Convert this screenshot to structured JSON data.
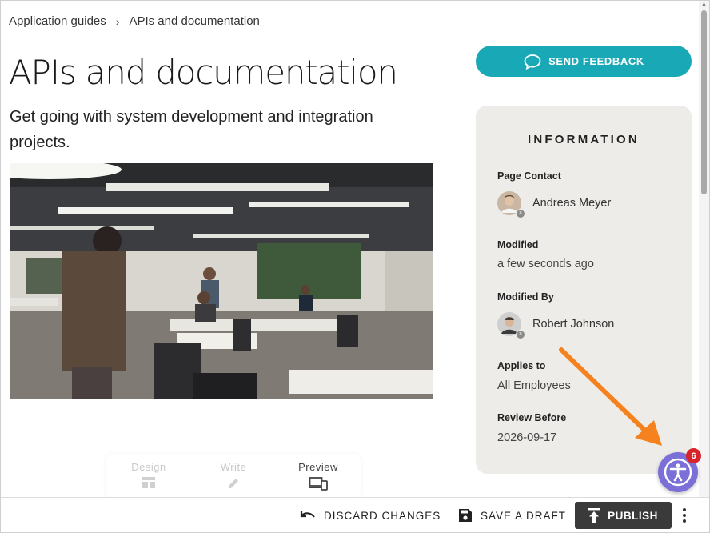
{
  "breadcrumb": {
    "parent": "Application guides",
    "separator": "›",
    "current": "APIs and documentation"
  },
  "page": {
    "title": "APIs and documentation",
    "subtitle": "Get going with system development and integration projects."
  },
  "feedback": {
    "label": "SEND FEEDBACK",
    "icon": "chat-bubble-icon",
    "color": "#19a9b6"
  },
  "info": {
    "heading": "INFORMATION",
    "page_contact_label": "Page Contact",
    "page_contact_name": "Andreas Meyer",
    "modified_label": "Modified",
    "modified_value": "a few seconds ago",
    "modified_by_label": "Modified By",
    "modified_by_name": "Robert Johnson",
    "applies_to_label": "Applies to",
    "applies_to_value": "All Employees",
    "review_before_label": "Review Before",
    "review_before_value": "2026-09-17"
  },
  "modes": {
    "design": "Design",
    "write": "Write",
    "preview": "Preview",
    "active": "Preview"
  },
  "toolbar": {
    "discard_label": "DISCARD CHANGES",
    "save_draft_label": "SAVE A DRAFT",
    "publish_label": "PUBLISH"
  },
  "accessibility": {
    "badge_count": "6",
    "color": "#7b6fd8",
    "badge_color": "#d9232a"
  },
  "annotation": {
    "arrow_color": "#f5821f"
  }
}
